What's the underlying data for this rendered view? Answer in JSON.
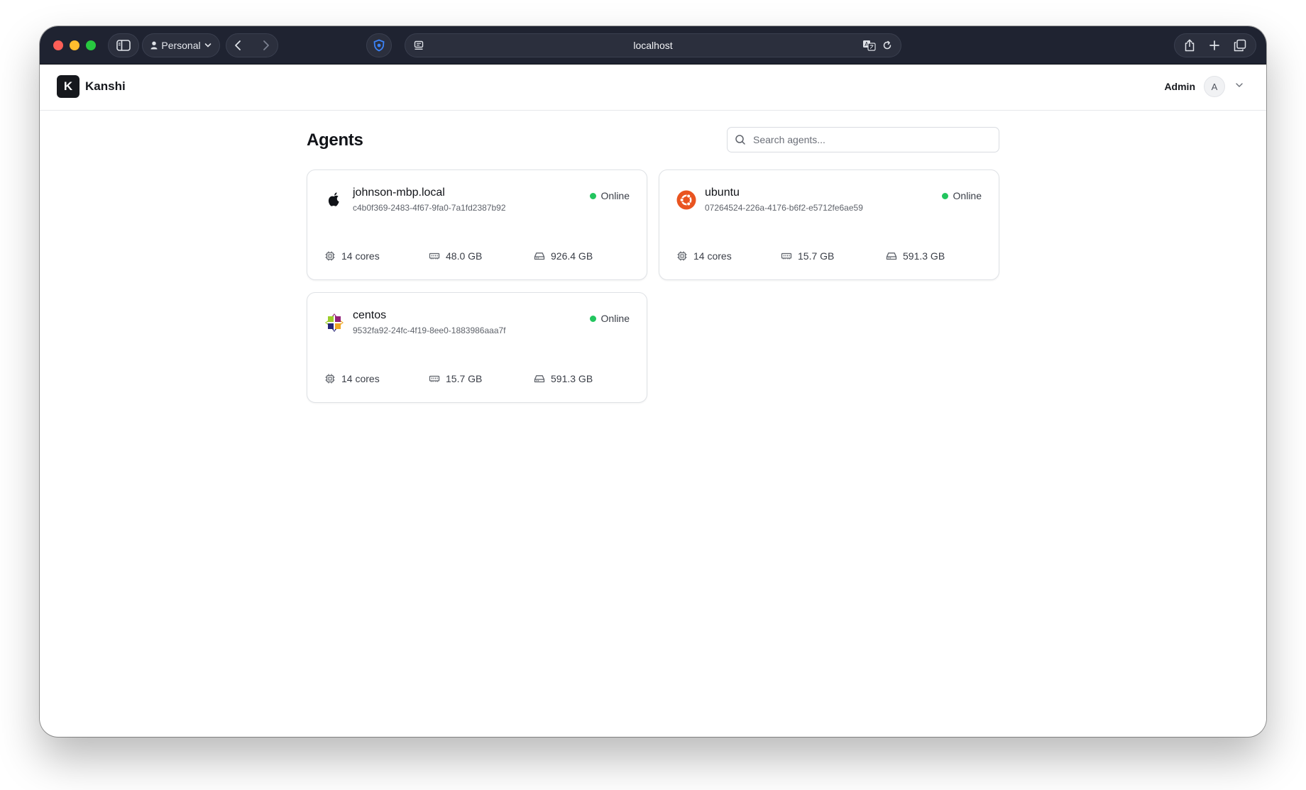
{
  "browser": {
    "profile_label": "Personal",
    "url": "localhost"
  },
  "app": {
    "brand_letter": "K",
    "brand_name": "Kanshi",
    "user_name": "Admin",
    "avatar_letter": "A"
  },
  "page": {
    "title": "Agents",
    "search_placeholder": "Search agents..."
  },
  "agents": [
    {
      "name": "johnson-mbp.local",
      "id": "c4b0f369-2483-4f67-9fa0-7a1fd2387b92",
      "os_icon": "apple-icon",
      "status": "Online",
      "status_color": "#22c55e",
      "cores": "14 cores",
      "memory": "48.0 GB",
      "disk": "926.4 GB"
    },
    {
      "name": "ubuntu",
      "id": "07264524-226a-4176-b6f2-e5712fe6ae59",
      "os_icon": "ubuntu-icon",
      "status": "Online",
      "status_color": "#22c55e",
      "cores": "14 cores",
      "memory": "15.7 GB",
      "disk": "591.3 GB"
    },
    {
      "name": "centos",
      "id": "9532fa92-24fc-4f19-8ee0-1883986aaa7f",
      "os_icon": "centos-icon",
      "status": "Online",
      "status_color": "#22c55e",
      "cores": "14 cores",
      "memory": "15.7 GB",
      "disk": "591.3 GB"
    }
  ],
  "colors": {
    "titlebar": "#1f2331",
    "online": "#22c55e",
    "ubuntu": "#e95420",
    "brand": "#16181d"
  }
}
